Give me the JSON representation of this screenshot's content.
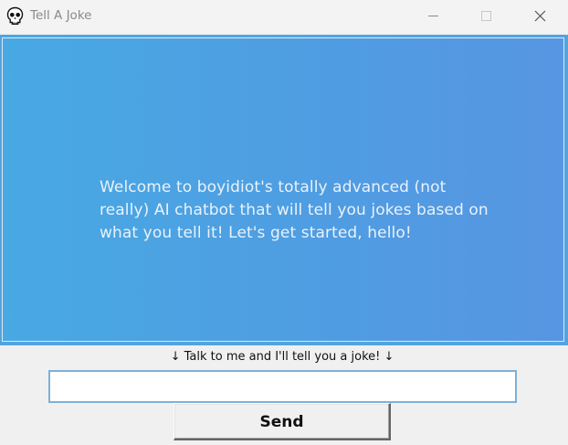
{
  "window": {
    "title": "Tell A Joke",
    "app_icon": "skull-icon",
    "controls": {
      "minimize_icon": "minimize-icon",
      "maximize_icon": "maximize-icon",
      "close_icon": "close-icon"
    }
  },
  "chat": {
    "message": "Welcome to boyidiot's totally advanced (not really) AI chatbot that will tell you jokes based on what you tell it! Let's get started, hello!",
    "background_color": "#4fa0e2",
    "text_color": "#e9f2fb"
  },
  "prompt": {
    "label": "↓ Talk to me and I'll tell you a joke! ↓"
  },
  "input": {
    "value": "",
    "placeholder": ""
  },
  "send_button": {
    "label": "Send"
  }
}
